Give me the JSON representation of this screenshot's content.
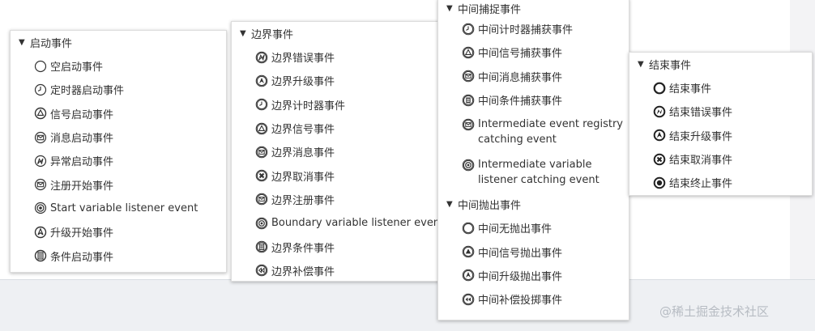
{
  "groups": {
    "start": {
      "title": "启动事件",
      "items": [
        "空启动事件",
        "定时器启动事件",
        "信号启动事件",
        "消息启动事件",
        "异常启动事件",
        "注册开始事件",
        "Start variable listener event",
        "升级开始事件",
        "条件启动事件"
      ]
    },
    "boundary": {
      "title": "边界事件",
      "items": [
        "边界错误事件",
        "边界升级事件",
        "边界计时器事件",
        "边界信号事件",
        "边界消息事件",
        "边界取消事件",
        "边界注册事件",
        "Boundary variable listener event",
        "边界条件事件",
        "边界补偿事件"
      ]
    },
    "catch": {
      "title": "中间捕捉事件",
      "items": [
        "中间计时器捕获事件",
        "中间信号捕获事件",
        "中间消息捕获事件",
        "中间条件捕获事件",
        "Intermediate event registry catching event",
        "Intermediate variable listener catching event"
      ]
    },
    "throw": {
      "title": "中间抛出事件",
      "items": [
        "中间无抛出事件",
        "中间信号抛出事件",
        "中间升级抛出事件",
        "中间补偿投掷事件"
      ]
    },
    "end": {
      "title": "结束事件",
      "items": [
        "结束事件",
        "结束错误事件",
        "结束升级事件",
        "结束取消事件",
        "结束终止事件"
      ]
    }
  },
  "watermark": "@稀土掘金技术社区"
}
